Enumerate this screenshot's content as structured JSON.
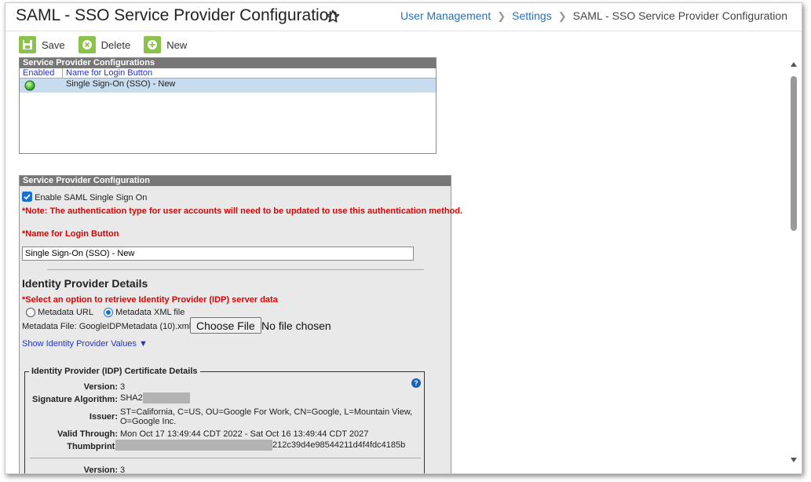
{
  "header": {
    "title": "SAML - SSO Service Provider Configuration",
    "breadcrumb": {
      "item1": "User Management",
      "item2": "Settings",
      "current": "SAML - SSO Service Provider Configuration"
    }
  },
  "toolbar": {
    "save_label": "Save",
    "delete_label": "Delete",
    "new_label": "New"
  },
  "list_panel": {
    "title": "Service Provider Configurations",
    "columns": {
      "enabled": "Enabled",
      "name": "Name for Login Button"
    },
    "rows": [
      {
        "name": "Single Sign-On (SSO) - New",
        "enabled": true
      }
    ]
  },
  "config_panel": {
    "title": "Service Provider Configuration",
    "enable_label": "Enable SAML Single Sign On",
    "enable_checked": true,
    "note": "*Note: The authentication type for user accounts will need to be updated to use this authentication method.",
    "name_label": "*Name for Login Button",
    "name_value": "Single Sign-On (SSO) - New",
    "idp_title": "Identity Provider Details",
    "idp_select_label": "*Select an option to retrieve Identity Provider (IDP) server data",
    "radio_url_label": "Metadata URL",
    "radio_xml_label": "Metadata XML file",
    "selected_option": "Metadata XML file",
    "metadata_file_label": "Metadata File: GoogleIDPMetadata (10).xml",
    "choose_file_label": "Choose File",
    "no_file_text": "No file chosen",
    "show_idp_link": "Show Identity Provider Values ▼",
    "cert": {
      "legend": "Identity Provider (IDP) Certificate Details",
      "version_label": "Version:",
      "version_value": "3",
      "sig_label": "Signature Algorithm:",
      "sig_value": "SHA2",
      "issuer_label": "Issuer:",
      "issuer_line1": "ST=California, C=US, OU=Google For Work, CN=Google, L=Mountain View,",
      "issuer_line2": "O=Google Inc.",
      "valid_label": "Valid Through:",
      "valid_value": "Mon Oct 17 13:49:44 CDT 2022 - Sat Oct 16 13:49:44 CDT 2027",
      "thumb_label": "Thumbprint:",
      "thumb_value": "212c39d4e98544211d4f4fdc4185b",
      "version2_label": "Version:",
      "version2_value": "3"
    }
  },
  "colors": {
    "accent_green": "#8bc34a",
    "link_blue": "#2a6fb0",
    "required_red": "#e00000",
    "panel_header": "#777777"
  }
}
